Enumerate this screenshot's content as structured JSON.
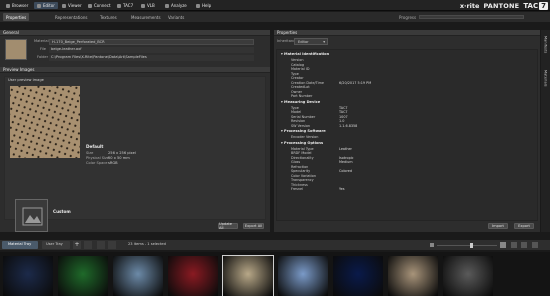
{
  "menu": [
    "Browser",
    "Editor",
    "Viewer",
    "Connect",
    "TAC7",
    "VLB",
    "Analyze",
    "Help"
  ],
  "brand": {
    "xrite": "x·rite",
    "pantone": "PANTONE",
    "tac": "TAC",
    "seven": "7"
  },
  "tabs": [
    "Properties",
    "Representations",
    "Textures",
    "Measurements",
    "Variants"
  ],
  "progress_label": "Progress",
  "general": {
    "header": "General",
    "material_label": "Material",
    "material_value": "H-170_Beige_Perforated_BCR",
    "file_label": "File",
    "file_value": "beige-leather.axf",
    "folder_label": "Folder",
    "folder_value": "C:\\Program Files\\X-Rite\\Pantone\\Data\\Art\\SampleFiles"
  },
  "preview": {
    "header": "Preview Images",
    "user_label": "User preview image",
    "default_label": "Default",
    "size_label": "Size",
    "size_value": "256 x 256 pixel",
    "physical_label": "Physical Size",
    "physical_value": "50 x 50 mm",
    "colorspace_label": "Color Space",
    "colorspace_value": "sRGB",
    "custom_label": "Custom",
    "update_all": "Update All",
    "export_all": "Export All"
  },
  "properties": {
    "header": "Properties",
    "inherited_label": "Inheritance",
    "inherited_value": "Editor",
    "sections": [
      {
        "title": "Material Identification",
        "rows": [
          [
            "Version",
            ""
          ],
          [
            "Catalog",
            ""
          ],
          [
            "Material ID",
            ""
          ],
          [
            "Type",
            ""
          ],
          [
            "Creator",
            ""
          ],
          [
            "Creation Date/Time",
            "6/20/2017 5:19 PM"
          ],
          [
            "CreatedLot",
            ""
          ],
          [
            "Owner",
            ""
          ],
          [
            "Part Number",
            ""
          ]
        ]
      },
      {
        "title": "Measuring Device",
        "rows": [
          [
            "Type",
            "TAC7"
          ],
          [
            "Model",
            "TAC7"
          ],
          [
            "Serial Number",
            "1007"
          ],
          [
            "Revision",
            "1.0"
          ],
          [
            "SW Version",
            "1.1.6.8358"
          ]
        ]
      },
      {
        "title": "Processing Software",
        "rows": [
          [
            "Encoder Version",
            ""
          ]
        ]
      },
      {
        "title": "Processing Options",
        "rows": [
          [
            "Material Type",
            "Leather"
          ],
          [
            "BRDF Model",
            ""
          ],
          [
            "Directionality",
            "Isotropic"
          ],
          [
            "Gloss",
            "Medium"
          ],
          [
            "Refraction",
            ""
          ],
          [
            "Specularity",
            "Colored"
          ],
          [
            "Color Variation",
            ""
          ],
          [
            "Transparency",
            ""
          ],
          [
            "Thickness",
            ""
          ],
          [
            "Fresnel",
            "Yes"
          ]
        ]
      }
    ],
    "import_label": "Import",
    "export_label": "Export"
  },
  "sidetabs": [
    "Manifests",
    "Materials"
  ],
  "bottom": {
    "tray_label": "Material Tray",
    "user_tray_label": "User Tray",
    "status": "23 items - 1 selected"
  },
  "thumbs": [
    "#1c2a4a",
    "#1f6a2a",
    "#6c8aa8",
    "#8a1a22",
    "#b8a888",
    "#7a9ac8",
    "#0a1a4a",
    "#a8947a",
    "#5a5a5a"
  ]
}
